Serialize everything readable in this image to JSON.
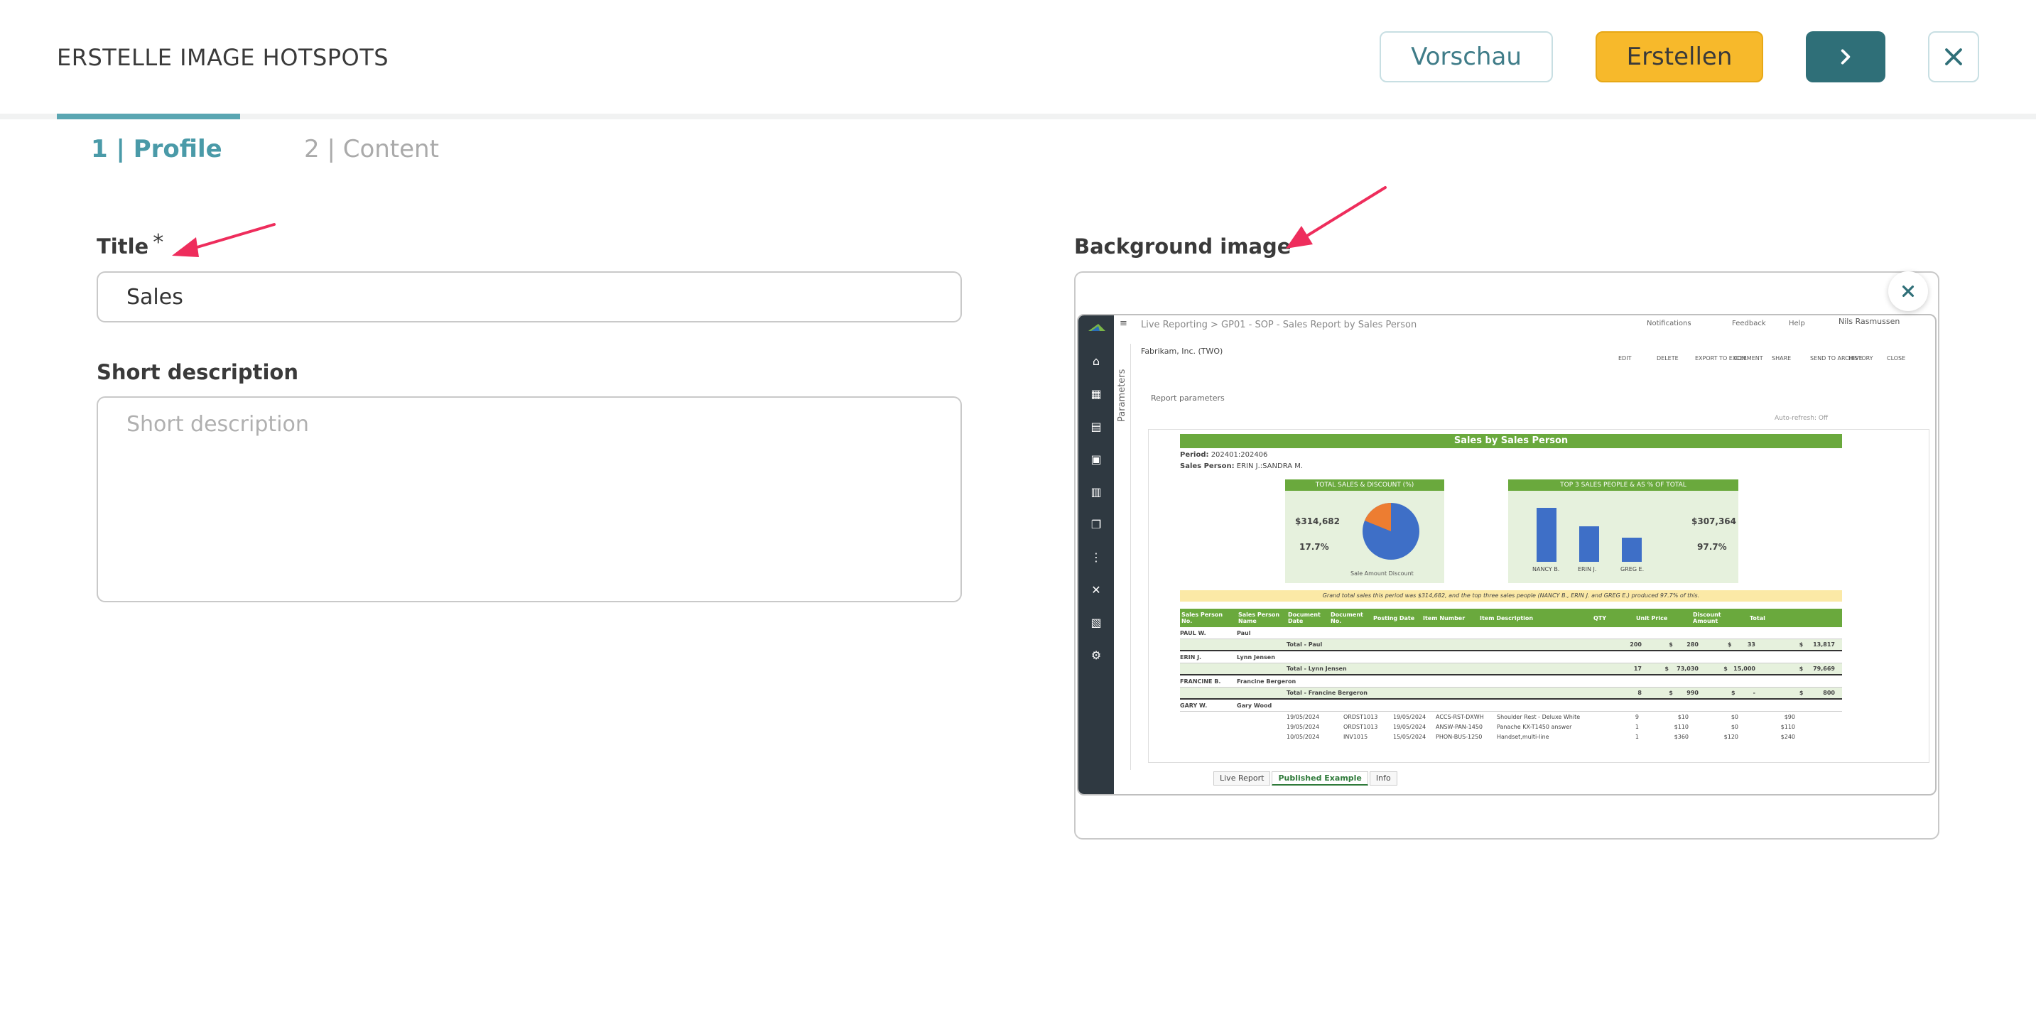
{
  "header": {
    "title": "ERSTELLE IMAGE HOTSPOTS",
    "preview_label": "Vorschau",
    "create_label": "Erstellen",
    "next_icon": "chevron-right-icon",
    "close_icon": "close-icon"
  },
  "tabs": [
    {
      "label": "1 | Profile",
      "active": true
    },
    {
      "label": "2 | Content",
      "active": false
    }
  ],
  "form": {
    "title_label": "Title",
    "title_value": "Sales",
    "required_mark": "*",
    "desc_label": "Short description",
    "desc_placeholder": "Short description",
    "bg_label": "Background image"
  },
  "preview": {
    "breadcrumb": "Live Reporting  >  GP01 - SOP - Sales Report by Sales Person",
    "notifications": "Notifications",
    "feedback": "Feedback",
    "help": "Help",
    "user": "Nils Rasmussen",
    "company": "Fabrikam, Inc. (TWO)",
    "toolbar": [
      "EDIT",
      "DELETE",
      "EXPORT TO EXCEL",
      "COMMENT",
      "SHARE",
      "SEND TO ARCHIVE",
      "HISTORY",
      "CLOSE"
    ],
    "parameters": "Parameters",
    "report_params": "Report parameters",
    "autorefresh": "Auto-refresh: Off",
    "report_title": "Sales by Sales Person",
    "period_label": "Period:",
    "period_value": "202401:202406",
    "salesperson_label": "Sales Person:",
    "salesperson_value": "ERIN J.:SANDRA M.",
    "chart1_title": "TOTAL SALES & DISCOUNT (%)",
    "chart1_value": "$314,682",
    "chart1_pct": "17.7%",
    "chart1_legend": "Sale Amount  Discount",
    "chart2_title": "TOP 3 SALES PEOPLE & AS % OF TOTAL",
    "chart2_value": "$307,364",
    "chart2_pct": "97.7%",
    "chart2_bars": [
      "NANCY B.",
      "ERIN J.",
      "GREG E."
    ],
    "summary": "Grand total sales this period was $314,682, and the top three sales people (NANCY B., ERIN J. and GREG E.) produced 97.7% of this.",
    "col_headers": [
      "Sales Person No.",
      "Sales Person Name",
      "Document Date",
      "Document No.",
      "Posting Date",
      "Item Number",
      "Item Description",
      "QTY",
      "Unit Price",
      "Discount Amount",
      "Total"
    ],
    "rows": [
      {
        "a": "PAUL W.",
        "b": "Paul",
        "type": "group"
      },
      {
        "label": "Total - Paul",
        "qty": "200",
        "price": "$       280",
        "disc": "$        33",
        "total": "$     13,817",
        "type": "total"
      },
      {
        "a": "ERIN J.",
        "b": "Lynn Jensen",
        "type": "group"
      },
      {
        "label": "Total - Lynn Jensen",
        "qty": "17",
        "price": "$    73,030",
        "disc": "$   15,000",
        "total": "$     79,669",
        "type": "total"
      },
      {
        "a": "FRANCINE B.",
        "b": "Francine Bergeron",
        "type": "group"
      },
      {
        "label": "Total - Francine Bergeron",
        "qty": "8",
        "price": "$       990",
        "disc": "$         -",
        "total": "$          800",
        "type": "total"
      },
      {
        "a": "GARY W.",
        "b": "Gary Wood",
        "type": "group"
      }
    ],
    "detail": [
      [
        "19/05/2024",
        "ORDST1013",
        "19/05/2024",
        "ACCS-RST-DXWH",
        "Shoulder Rest - Deluxe White",
        "9",
        "$10",
        "$0",
        "$90"
      ],
      [
        "19/05/2024",
        "ORDST1013",
        "19/05/2024",
        "ANSW-PAN-1450",
        "Panache KX-T1450 answer",
        "1",
        "$110",
        "$0",
        "$110"
      ],
      [
        "10/05/2024",
        "INV1015",
        "15/05/2024",
        "PHON-BUS-1250",
        "Handset,multi-line",
        "1",
        "$360",
        "$120",
        "$240"
      ]
    ],
    "sheet_tabs": [
      "Live Report",
      "Published Example",
      "Info"
    ]
  }
}
